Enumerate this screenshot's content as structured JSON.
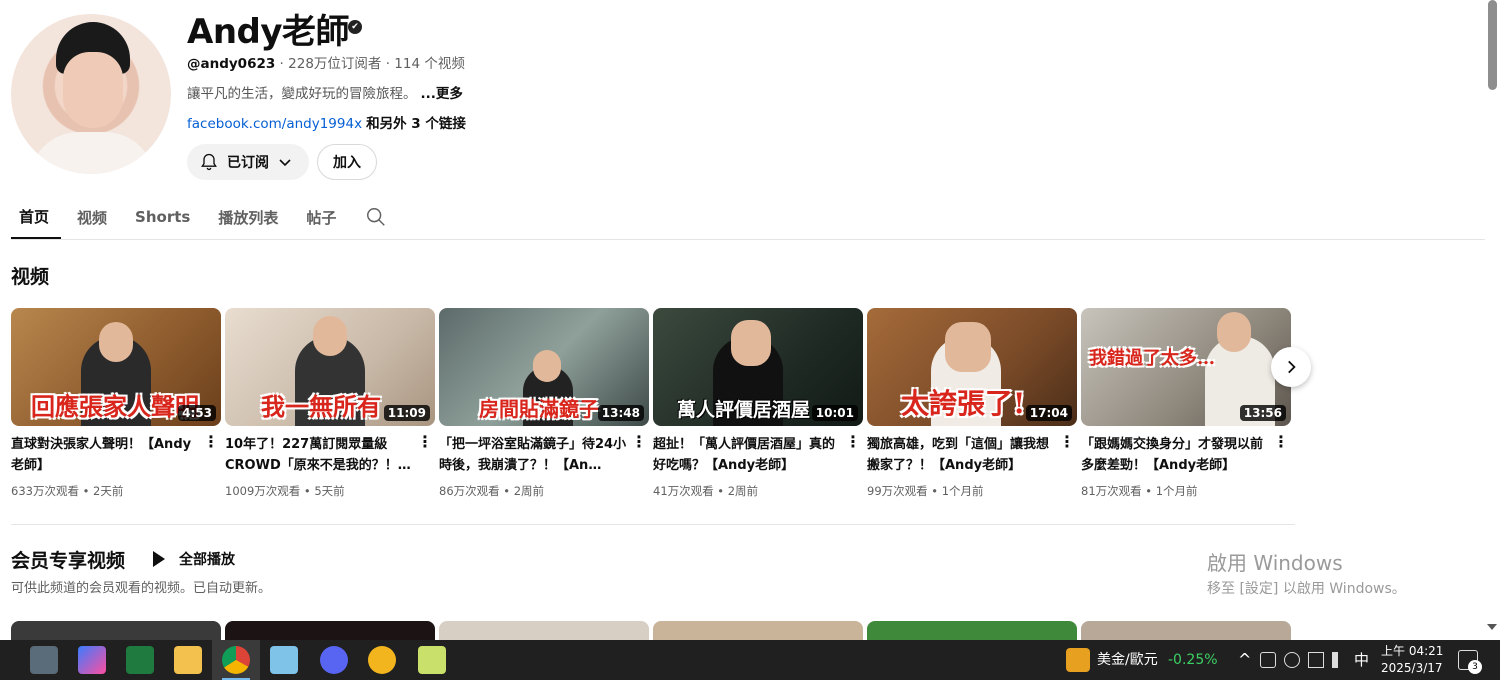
{
  "channel": {
    "name": "Andy老師",
    "handle": "@andy0623",
    "stats": " · 228万位订阅者 · 114 个视频",
    "description": "讓平凡的生活，變成好玩的冒險旅程。",
    "more": "...更多",
    "link": "facebook.com/andy1994x",
    "link_extra": "和另外 3 个链接",
    "subscribe_label": "已订阅",
    "join_label": "加入"
  },
  "tabs": [
    "首页",
    "视频",
    "Shorts",
    "播放列表",
    "帖子"
  ],
  "videos_section_title": "视频",
  "videos": [
    {
      "title": "直球對決張家人聲明！【Andy老師】",
      "overlay": "回應張家人聲明",
      "duration": "4:53",
      "stats": "633万次观看 • 2天前"
    },
    {
      "title": "10年了！227萬訂閱眾量級CROWD「原來不是我的？！…",
      "overlay": "我一無所有",
      "duration": "11:09",
      "stats": "1009万次观看 • 5天前"
    },
    {
      "title": "「把一坪浴室貼滿鏡子」待24小時後，我崩潰了？！【An…",
      "overlay": "房間貼滿鏡子",
      "duration": "13:48",
      "stats": "86万次观看 • 2周前"
    },
    {
      "title": "超扯！「萬人評價居酒屋」真的好吃嗎？【Andy老師】",
      "overlay": "萬人評價居酒屋",
      "duration": "10:01",
      "stats": "41万次观看 • 2周前"
    },
    {
      "title": "獨旅高雄，吃到「這個」讓我想搬家了？！【Andy老師】",
      "overlay": "太誇張了!",
      "duration": "17:04",
      "stats": "99万次观看 • 1个月前"
    },
    {
      "title": "「跟媽媽交換身分」才發現以前多麼差勁！【Andy老師】",
      "overlay": "我錯過了太多…",
      "duration": "13:56",
      "stats": "81万次观看 • 1个月前"
    }
  ],
  "members_section": {
    "title": "会员专享视频",
    "play_all": "全部播放",
    "subtitle": "可供此频道的会员观看的视频。已自动更新。"
  },
  "watermark": {
    "line1": "啟用 Windows",
    "line2": "移至 [設定] 以啟用 Windows。"
  },
  "taskbar": {
    "stock_name": "美金/歐元",
    "stock_change": "-0.25%",
    "ime": "中",
    "time": "上午 04:21",
    "date": "2025/3/17",
    "notification_count": "3"
  }
}
